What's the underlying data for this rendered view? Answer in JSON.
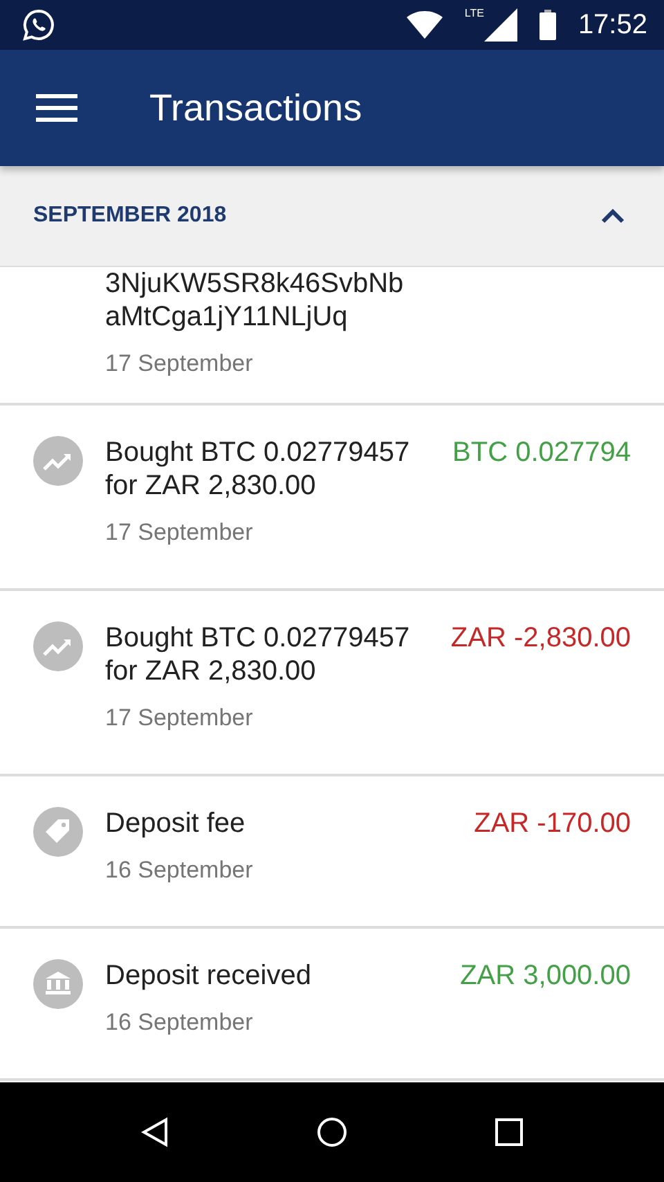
{
  "status_bar": {
    "network_label": "LTE",
    "time": "17:52"
  },
  "app_bar": {
    "title": "Transactions"
  },
  "section": {
    "title": "SEPTEMBER 2018",
    "expanded": true
  },
  "transactions": [
    {
      "title_lines": [
        "3NjuKW5SR8k46SvbNb",
        "aMtCga1jY11NLjUq"
      ],
      "date": "17 September"
    },
    {
      "kind": "trade",
      "title_lines": [
        "Bought BTC 0.02779457",
        "for ZAR 2,830.00"
      ],
      "date": "17 September",
      "amount": "BTC 0.027794",
      "color": "#43a047"
    },
    {
      "kind": "trade",
      "title_lines": [
        "Bought BTC 0.02779457",
        "for ZAR 2,830.00"
      ],
      "date": "17 September",
      "amount": "ZAR -2,830.00",
      "color": "#c62828"
    },
    {
      "kind": "fee",
      "title_lines": [
        "Deposit fee"
      ],
      "date": "16 September",
      "amount": "ZAR -170.00",
      "color": "#c62828"
    },
    {
      "kind": "deposit",
      "title_lines": [
        "Deposit received"
      ],
      "date": "16 September",
      "amount": "ZAR 3,000.00",
      "color": "#43a047"
    }
  ]
}
